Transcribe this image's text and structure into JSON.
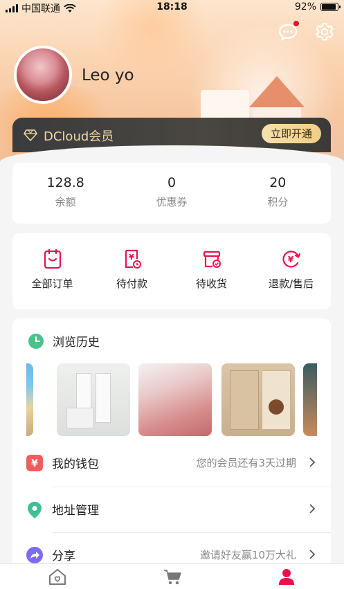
{
  "status_bar": {
    "carrier": "中国联通",
    "time": "18:18",
    "battery": "92%"
  },
  "profile": {
    "username": "Leo yo"
  },
  "vip": {
    "label": "DCloud会员",
    "button": "立即开通"
  },
  "stats": [
    {
      "value": "128.8",
      "label": "余额"
    },
    {
      "value": "0",
      "label": "优惠券"
    },
    {
      "value": "20",
      "label": "积分"
    }
  ],
  "orders": [
    {
      "label": "全部订单",
      "icon": "all-orders-icon"
    },
    {
      "label": "待付款",
      "icon": "pending-payment-icon"
    },
    {
      "label": "待收货",
      "icon": "pending-delivery-icon"
    },
    {
      "label": "退款/售后",
      "icon": "refund-icon"
    }
  ],
  "history": {
    "title": "浏览历史"
  },
  "menu": [
    {
      "label": "我的钱包",
      "sub": "您的会员还有3天过期",
      "icon": "wallet-icon"
    },
    {
      "label": "地址管理",
      "sub": "",
      "icon": "location-icon"
    },
    {
      "label": "分享",
      "sub": "邀请好友赢10万大礼",
      "icon": "share-icon"
    }
  ],
  "colors": {
    "accent": "#e8114c",
    "vip_gold": "#f2d7a3",
    "wallet": "#ef5d5d",
    "location": "#3fbf95",
    "share": "#7b6cf6",
    "history": "#4cc28a"
  },
  "tabbar": [
    "home-icon",
    "cart-icon",
    "user-icon"
  ]
}
